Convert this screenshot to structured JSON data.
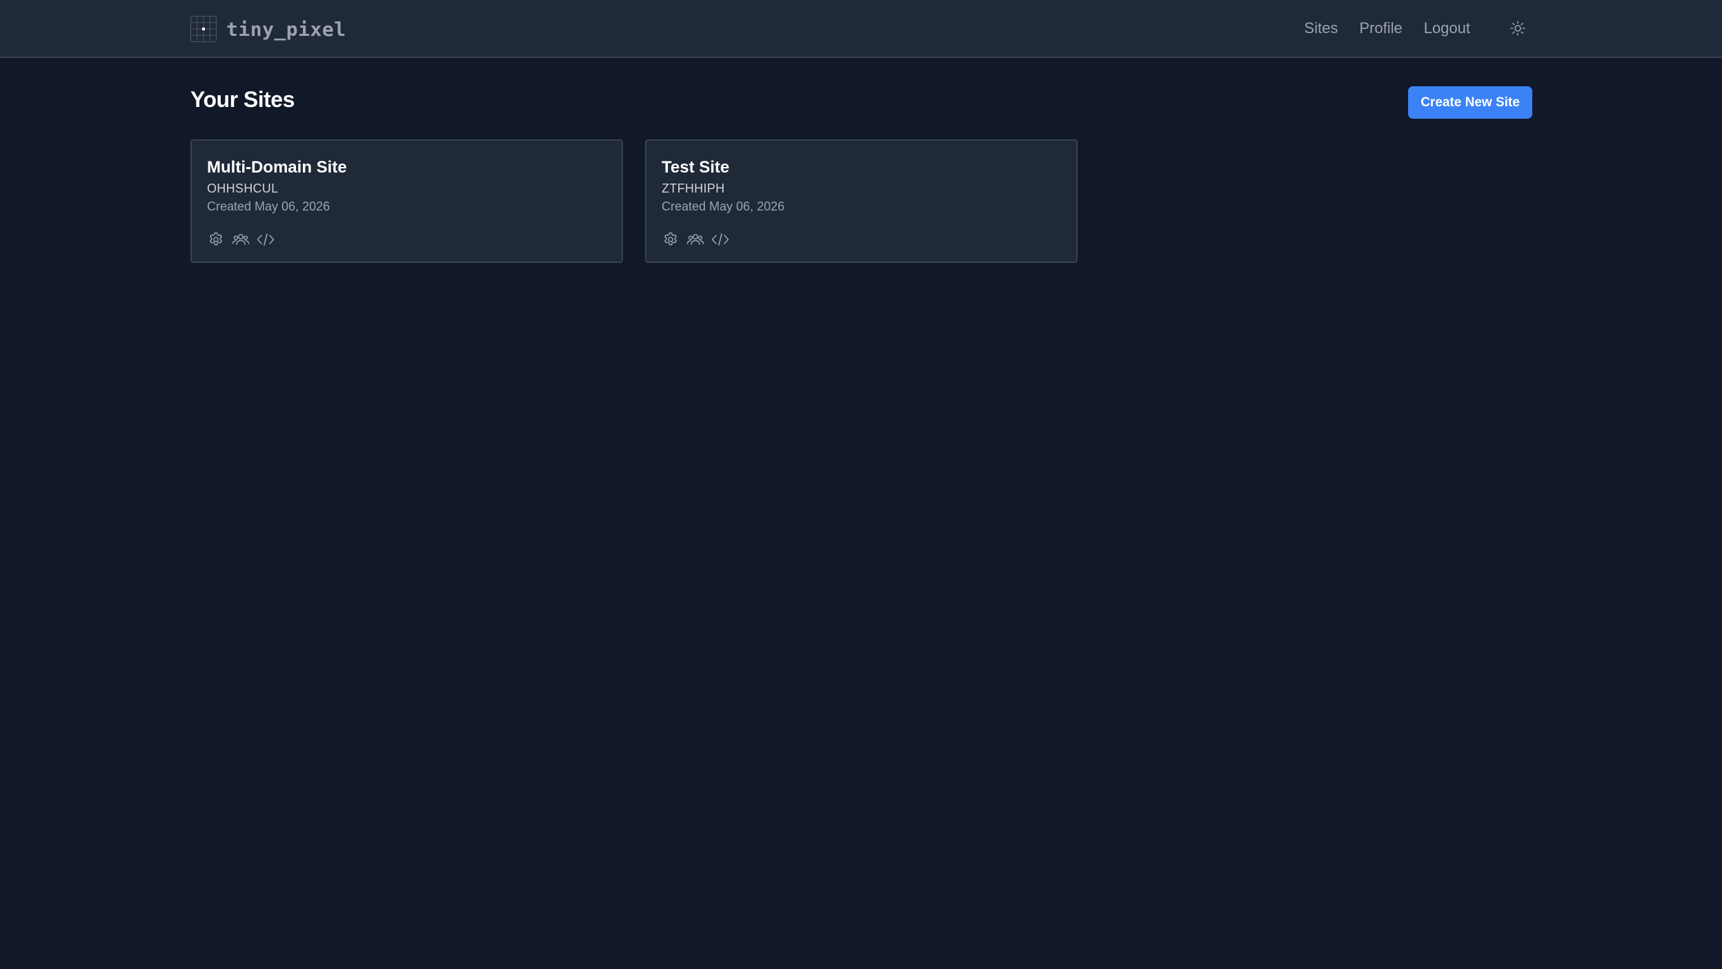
{
  "brand": {
    "name": "tiny_pixel",
    "icon": "pixel-grid-icon"
  },
  "nav": {
    "items": [
      {
        "label": "Sites"
      },
      {
        "label": "Profile"
      },
      {
        "label": "Logout"
      }
    ],
    "theme_toggle_icon": "sun-icon"
  },
  "page": {
    "title": "Your Sites",
    "create_button_label": "Create New Site"
  },
  "sites": [
    {
      "name": "Multi-Domain Site",
      "code": "OHHSHCUL",
      "created": "Created May 06, 2026",
      "actions": [
        "settings-icon",
        "users-icon",
        "code-icon"
      ]
    },
    {
      "name": "Test Site",
      "code": "ZTFHHIPH",
      "created": "Created May 06, 2026",
      "actions": [
        "settings-icon",
        "users-icon",
        "code-icon"
      ]
    }
  ],
  "colors": {
    "background": "#111827",
    "surface": "#1f2937",
    "border": "#374151",
    "accent": "#3b82f6",
    "muted_text": "#9ca3af"
  }
}
